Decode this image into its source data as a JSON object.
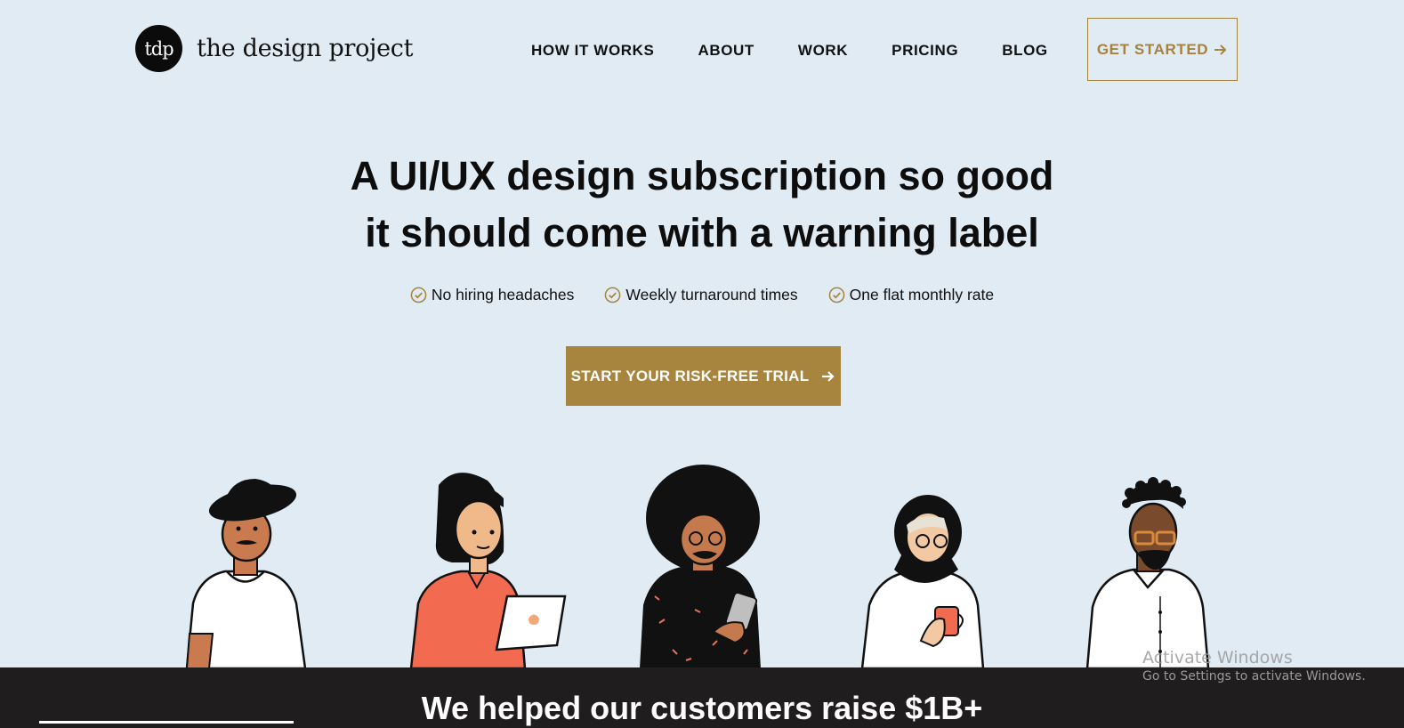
{
  "brand": {
    "badge": "tdp",
    "name": "the design project"
  },
  "nav": {
    "items": [
      {
        "label": "HOW IT WORKS"
      },
      {
        "label": "ABOUT"
      },
      {
        "label": "WORK"
      },
      {
        "label": "PRICING"
      },
      {
        "label": "BLOG"
      }
    ],
    "cta_label": "GET STARTED",
    "cta_icon": "arrow-right-icon"
  },
  "hero": {
    "title_line1": "A UI/UX design subscription so good",
    "title_line2": "it should come with a warning label",
    "features": [
      {
        "label": "No hiring headaches",
        "icon": "check-circle-icon"
      },
      {
        "label": "Weekly turnaround times",
        "icon": "check-circle-icon"
      },
      {
        "label": "One flat monthly rate",
        "icon": "check-circle-icon"
      }
    ],
    "cta_label": "START YOUR RISK-FREE TRIAL",
    "cta_icon": "arrow-right-icon"
  },
  "banner": {
    "title": "We helped our customers raise $1B+"
  },
  "watermark": {
    "title": "Activate Windows",
    "subtitle": "Go to Settings to activate Windows."
  },
  "colors": {
    "background": "#e0ebf4",
    "accent": "#a8853f",
    "dark_band": "#1f1d1e"
  }
}
